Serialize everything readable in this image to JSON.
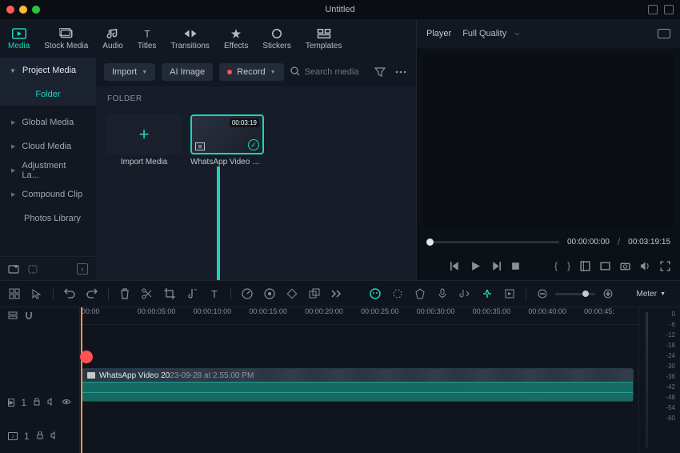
{
  "window": {
    "title": "Untitled"
  },
  "main_tabs": [
    {
      "label": "Media",
      "icon": "media"
    },
    {
      "label": "Stock Media",
      "icon": "stock"
    },
    {
      "label": "Audio",
      "icon": "audio"
    },
    {
      "label": "Titles",
      "icon": "titles"
    },
    {
      "label": "Transitions",
      "icon": "transitions"
    },
    {
      "label": "Effects",
      "icon": "effects"
    },
    {
      "label": "Stickers",
      "icon": "stickers"
    },
    {
      "label": "Templates",
      "icon": "templates"
    }
  ],
  "sidebar": {
    "header": "Project Media",
    "folder_button": "Folder",
    "items": [
      {
        "label": "Global Media",
        "chev": true
      },
      {
        "label": "Cloud Media",
        "chev": true
      },
      {
        "label": "Adjustment La...",
        "chev": true
      },
      {
        "label": "Compound Clip",
        "chev": true
      },
      {
        "label": "Photos Library",
        "chev": false
      }
    ]
  },
  "mid_toolbar": {
    "import": "Import",
    "ai_image": "AI Image",
    "record": "Record",
    "search_placeholder": "Search media"
  },
  "folder_label": "FOLDER",
  "media_tiles": {
    "import": {
      "label": "Import Media"
    },
    "clip": {
      "duration": "00:03:19",
      "label": "WhatsApp Video 202..."
    }
  },
  "player": {
    "label": "Player",
    "quality": "Full Quality",
    "cur_time": "00:00:00:00",
    "separator": "/",
    "total_time": "00:03:19:15"
  },
  "timeline": {
    "ruler": [
      "00:00",
      "00:00:05:00",
      "00:00:10:00",
      "00:00:15:00",
      "00:00:20:00",
      "00:00:25:00",
      "00:00:30:00",
      "00:00:35:00",
      "00:00:40:00",
      "00:00:45:"
    ],
    "clip_name": "WhatsApp Video 2023-09-28 at 2.55.00 PM",
    "meter_label": "Meter",
    "meter_ticks": [
      "0",
      "-6",
      "-12",
      "-18",
      "-24",
      "-30",
      "-36",
      "-42",
      "-48",
      "-54",
      "-60"
    ],
    "video_track": "1",
    "audio_track": "1"
  }
}
